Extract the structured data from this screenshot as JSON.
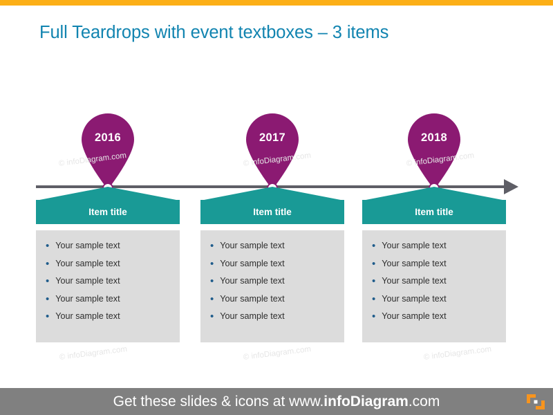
{
  "slide": {
    "title": "Full Teardrops with event textboxes – 3 items",
    "title_color": "#1184B0",
    "accent_top_color": "#FCAF17",
    "background": "#FFFFFF"
  },
  "timeline": {
    "axis_color": "#5E5E66",
    "arrow_direction": "right",
    "marker_color": "#8B1A72",
    "marker_dot_fill": "#FFFFFF"
  },
  "columns": [
    {
      "year": "2016",
      "title": "Item title",
      "head_color": "#199A96",
      "body_color": "#DCDCDC",
      "bullets": [
        "Your sample text",
        "Your sample text",
        "Your sample text",
        "Your sample text",
        "Your sample text"
      ]
    },
    {
      "year": "2017",
      "title": "Item title",
      "head_color": "#199A96",
      "body_color": "#DCDCDC",
      "bullets": [
        "Your sample text",
        "Your sample text",
        "Your sample text",
        "Your sample text",
        "Your sample text"
      ]
    },
    {
      "year": "2018",
      "title": "Item title",
      "head_color": "#199A96",
      "body_color": "#DCDCDC",
      "bullets": [
        "Your sample text",
        "Your sample text",
        "Your sample text",
        "Your sample text",
        "Your sample text"
      ]
    }
  ],
  "watermarks": [
    "© infoDiagram.com",
    "© infoDiagram.com",
    "© infoDiagram.com",
    "© infoDiagram.com",
    "© infoDiagram.com",
    "© infoDiagram.com"
  ],
  "footer": {
    "text_prefix": "Get these slides & icons at www.",
    "text_brand": "infoDiagram",
    "text_suffix": ".com",
    "bar_color": "#808080",
    "logo_color": "#F7941E",
    "logo_name": "infodiagram-logo"
  }
}
